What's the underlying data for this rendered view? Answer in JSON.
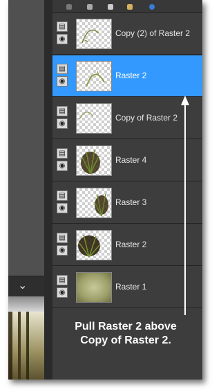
{
  "layers_panel": {
    "layers": [
      {
        "name": "Copy (2) of Raster 2",
        "selected": false,
        "thumb": "curve-small"
      },
      {
        "name": "Raster 2",
        "selected": true,
        "thumb": "curve"
      },
      {
        "name": "Copy of Raster 2",
        "selected": false,
        "thumb": "curve-faint"
      },
      {
        "name": "Raster 4",
        "selected": false,
        "thumb": "fern"
      },
      {
        "name": "Raster 3",
        "selected": false,
        "thumb": "fern-small"
      },
      {
        "name": "Raster 2",
        "selected": false,
        "thumb": "fern-dark"
      },
      {
        "name": "Raster 1",
        "selected": false,
        "thumb": "gradient-fill"
      }
    ],
    "toggle_icons": [
      "layer-group-icon",
      "eye-icon"
    ]
  },
  "left_panel": {
    "collapse_icon": "chevron-down-icon",
    "collapse_glyph": "⌄"
  },
  "annotation": {
    "line1": "Pull Raster 2 above",
    "line2": "Copy of Raster 2."
  },
  "colors": {
    "selection": "#3399ff",
    "panel_bg": "#3d3d3d",
    "text": "#e6e6e6"
  }
}
